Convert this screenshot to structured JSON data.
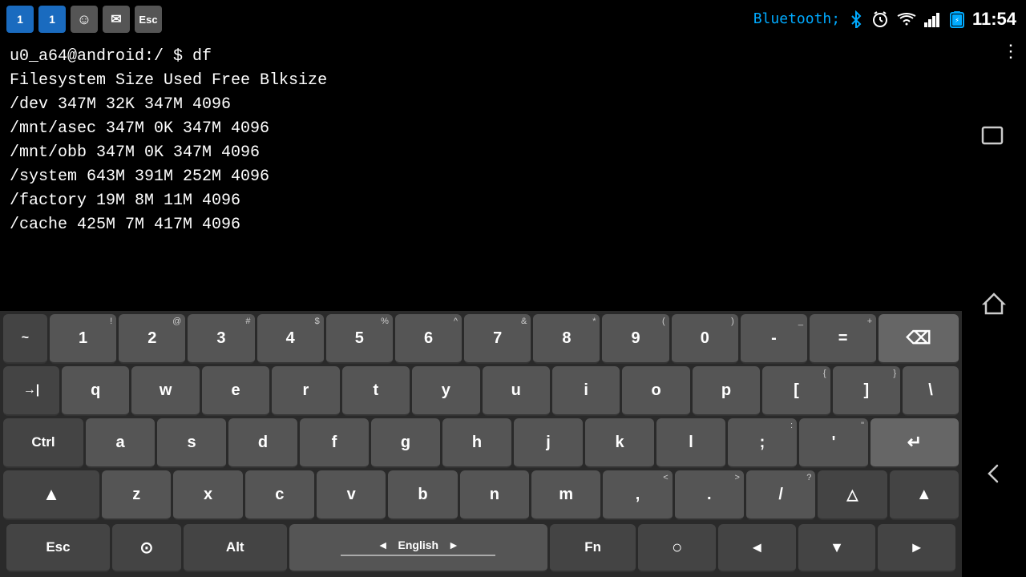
{
  "statusBar": {
    "time": "11:54",
    "notifIcons": [
      {
        "id": "n1",
        "label": "1",
        "type": "blue-bg"
      },
      {
        "id": "n2",
        "label": "1",
        "type": "blue-bg"
      },
      {
        "id": "n3",
        "label": "☺",
        "type": "chat"
      },
      {
        "id": "n4",
        "label": "✉",
        "type": "mail"
      },
      {
        "id": "n5",
        "label": "Esc",
        "type": "esc-btn"
      }
    ]
  },
  "terminal": {
    "prompt": "u0_a64@android:/ $ df",
    "columns": "Filesystem                     Size    Used    Free  Blksize",
    "rows": [
      "/dev                           347M     32K    347M     4096",
      "/mnt/asec                      347M      0K    347M     4096",
      "/mnt/obb                       347M      0K    347M     4096",
      "/system                        643M    391M    252M     4096",
      "/factory                        19M      8M     11M     4096",
      "/cache                         425M      7M    417M     4096"
    ]
  },
  "keyboard": {
    "row1": [
      {
        "label": "~",
        "sub": "",
        "id": "tilde"
      },
      {
        "label": "1",
        "sub": "!",
        "id": "1"
      },
      {
        "label": "2",
        "sub": "@",
        "id": "2"
      },
      {
        "label": "3",
        "sub": "#",
        "id": "3"
      },
      {
        "label": "4",
        "sub": "$",
        "id": "4"
      },
      {
        "label": "5",
        "sub": "%",
        "id": "5"
      },
      {
        "label": "6",
        "sub": "^",
        "id": "6"
      },
      {
        "label": "7",
        "sub": "&",
        "id": "7"
      },
      {
        "label": "8",
        "sub": "*",
        "id": "8"
      },
      {
        "label": "9",
        "sub": "(",
        "id": "9"
      },
      {
        "label": "0",
        "sub": ")",
        "id": "0"
      },
      {
        "label": "-",
        "sub": "_",
        "id": "minus"
      },
      {
        "label": "=",
        "sub": "+",
        "id": "equals"
      },
      {
        "label": "⌫",
        "sub": "",
        "id": "backspace"
      }
    ],
    "row2": [
      {
        "label": "→|",
        "sub": "",
        "id": "tab"
      },
      {
        "label": "q",
        "sub": "",
        "id": "q"
      },
      {
        "label": "w",
        "sub": "",
        "id": "w"
      },
      {
        "label": "e",
        "sub": "",
        "id": "e"
      },
      {
        "label": "r",
        "sub": "",
        "id": "r"
      },
      {
        "label": "t",
        "sub": "",
        "id": "t"
      },
      {
        "label": "y",
        "sub": "",
        "id": "y"
      },
      {
        "label": "u",
        "sub": "",
        "id": "u"
      },
      {
        "label": "i",
        "sub": "",
        "id": "i"
      },
      {
        "label": "o",
        "sub": "",
        "id": "o"
      },
      {
        "label": "p",
        "sub": "",
        "id": "p"
      },
      {
        "label": "[",
        "sub": "{",
        "id": "lbracket"
      },
      {
        "label": "]",
        "sub": "}",
        "id": "rbracket"
      },
      {
        "label": "\\",
        "sub": "|",
        "id": "backslash"
      }
    ],
    "row3": [
      {
        "label": "Ctrl",
        "sub": "",
        "id": "ctrl"
      },
      {
        "label": "a",
        "sub": "",
        "id": "a"
      },
      {
        "label": "s",
        "sub": "",
        "id": "s"
      },
      {
        "label": "d",
        "sub": "",
        "id": "d"
      },
      {
        "label": "f",
        "sub": "",
        "id": "f"
      },
      {
        "label": "g",
        "sub": "",
        "id": "g"
      },
      {
        "label": "h",
        "sub": "",
        "id": "h"
      },
      {
        "label": "j",
        "sub": "",
        "id": "j"
      },
      {
        "label": "k",
        "sub": "",
        "id": "k"
      },
      {
        "label": "l",
        "sub": "",
        "id": "l"
      },
      {
        "label": ";",
        "sub": ":",
        "id": "semicolon"
      },
      {
        "label": "'",
        "sub": "\"",
        "id": "quote"
      },
      {
        "label": "↵",
        "sub": "",
        "id": "enter"
      }
    ],
    "row4": [
      {
        "label": "▲",
        "sub": "",
        "id": "shift-left"
      },
      {
        "label": "z",
        "sub": "",
        "id": "z"
      },
      {
        "label": "x",
        "sub": "",
        "id": "x"
      },
      {
        "label": "c",
        "sub": "",
        "id": "c"
      },
      {
        "label": "v",
        "sub": "",
        "id": "v"
      },
      {
        "label": "b",
        "sub": "",
        "id": "b"
      },
      {
        "label": "n",
        "sub": "",
        "id": "n"
      },
      {
        "label": "m",
        "sub": "",
        "id": "m"
      },
      {
        "label": ",",
        "sub": "<",
        "id": "comma"
      },
      {
        "label": ".",
        "sub": ">",
        "id": "period"
      },
      {
        "label": "/",
        "sub": "?",
        "id": "slash"
      },
      {
        "label": "△",
        "sub": "",
        "id": "up-arrow"
      },
      {
        "label": "▲",
        "sub": "",
        "id": "shift-right"
      }
    ],
    "row5": {
      "esc": "Esc",
      "settings": "⊙",
      "alt": "Alt",
      "langLeft": "◄",
      "langLabel": "English",
      "langRight": "►",
      "fn": "Fn",
      "circle": "○",
      "left": "◄",
      "down": "▼",
      "right": "►"
    }
  },
  "rightNav": {
    "icons": [
      "⋮",
      "⌂",
      "❮"
    ]
  }
}
